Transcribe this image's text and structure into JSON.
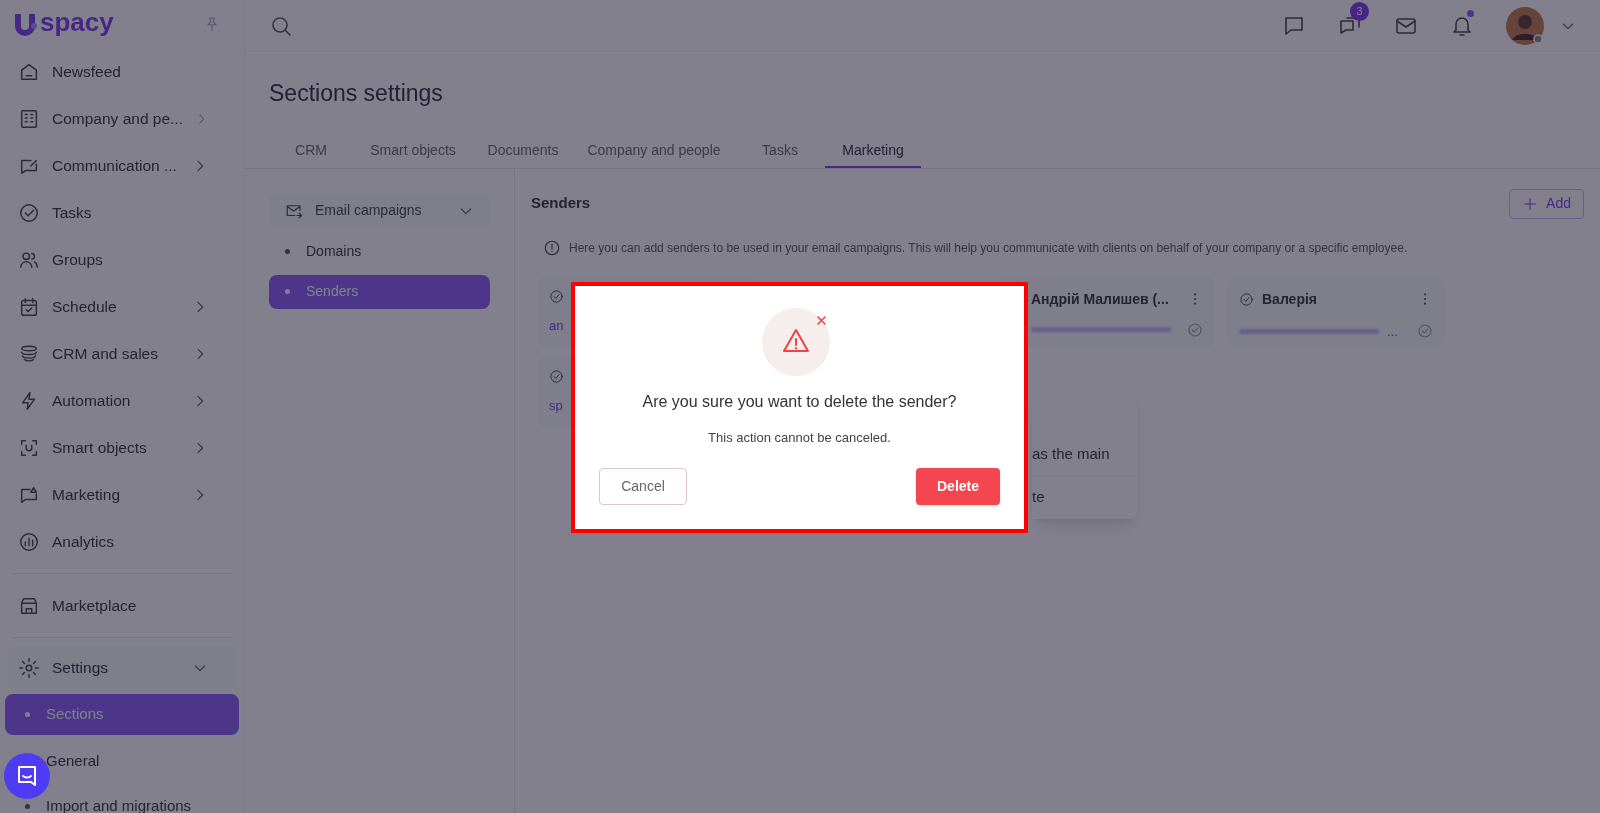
{
  "logo": {
    "text": "spacy"
  },
  "sidebar": {
    "items": [
      {
        "label": "Newsfeed",
        "expandable": false
      },
      {
        "label": "Company and pe...",
        "expandable": true
      },
      {
        "label": "Communication ...",
        "expandable": true
      },
      {
        "label": "Tasks",
        "expandable": false
      },
      {
        "label": "Groups",
        "expandable": false
      },
      {
        "label": "Schedule",
        "expandable": true
      },
      {
        "label": "CRM and sales",
        "expandable": true
      },
      {
        "label": "Automation",
        "expandable": true
      },
      {
        "label": "Smart objects",
        "expandable": true
      },
      {
        "label": "Marketing",
        "expandable": true
      },
      {
        "label": "Analytics",
        "expandable": false
      },
      {
        "label": "Marketplace",
        "expandable": false
      }
    ],
    "settings": {
      "label": "Settings",
      "expanded": true,
      "children": [
        {
          "label": "Sections",
          "selected": true
        },
        {
          "label": "General",
          "selected": false
        },
        {
          "label": "Import and migrations",
          "selected": false
        }
      ]
    }
  },
  "header": {
    "chats_badge": "3",
    "notifications_dot": true
  },
  "page": {
    "title": "Sections settings",
    "tabs": [
      {
        "label": "CRM",
        "selected": false
      },
      {
        "label": "Smart objects",
        "selected": false
      },
      {
        "label": "Documents",
        "selected": false
      },
      {
        "label": "Company and people",
        "selected": false
      },
      {
        "label": "Tasks",
        "selected": false
      },
      {
        "label": "Marketing",
        "selected": true
      }
    ],
    "submenu": {
      "label": "Email campaigns",
      "expanded": true,
      "items": [
        {
          "label": "Domains",
          "selected": false
        },
        {
          "label": "Senders",
          "selected": true
        }
      ]
    },
    "senders": {
      "title": "Senders",
      "add_button": "Add",
      "info": "Here you can add senders to be used in your email campaigns. This will help you communicate with clients on behalf of your company or a specific employee.",
      "cards": [
        {
          "email": "an"
        },
        {
          "name": "Андрій Малишев (..."
        },
        {
          "name": "Валерія",
          "email": "..."
        },
        {
          "email": "sp"
        }
      ],
      "context_menu": [
        "as the main",
        "te"
      ]
    }
  },
  "dialog": {
    "title": "Are you sure you want to delete the sender?",
    "message": "This action cannot be canceled.",
    "cancel": "Cancel",
    "confirm": "Delete"
  }
}
